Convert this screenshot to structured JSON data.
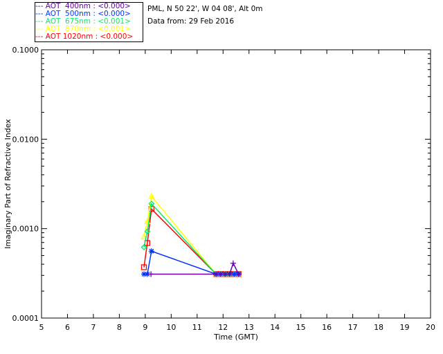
{
  "legend": [
    {
      "label": "--- AOT  400nm : <0.000>",
      "color": "#6600aa"
    },
    {
      "label": "--- AOT  500nm : <0.000>",
      "color": "#0033ff"
    },
    {
      "label": "--- AOT  675nm : <0.001>",
      "color": "#00ee66"
    },
    {
      "label": "--- AOT  870nm : <0.001>",
      "color": "#ffff00"
    },
    {
      "label": "--- AOT 1020nm : <0.000>",
      "color": "#ff0000"
    }
  ],
  "header": {
    "location": "PML, N 50 22', W 04 08', Alt 0m",
    "date": "Data from: 29 Feb 2016"
  },
  "chart_data": {
    "type": "line",
    "xlabel": "Time (GMT)",
    "ylabel": "Imaginary Part of Refractive Index",
    "xlim": [
      5,
      20
    ],
    "ylim": [
      0.0001,
      0.1
    ],
    "yscale": "log",
    "xticks": [
      "5",
      "6",
      "7",
      "8",
      "9",
      "10",
      "11",
      "12",
      "13",
      "14",
      "15",
      "16",
      "17",
      "18",
      "19",
      "20"
    ],
    "yticks": [
      "0.0001",
      "0.0010",
      "0.0100",
      "0.1000"
    ],
    "series": [
      {
        "name": "AOT 400nm",
        "color": "#6600aa",
        "marker": "plus",
        "x": [
          9.22,
          11.73,
          11.9,
          12.08,
          12.25,
          12.39,
          12.6
        ],
        "y": [
          0.00031,
          0.00031,
          0.00031,
          0.00031,
          0.00031,
          0.00041,
          0.00031
        ]
      },
      {
        "name": "AOT 500nm",
        "color": "#0033ff",
        "marker": "asterisk",
        "x": [
          8.95,
          9.08,
          9.24,
          11.73,
          11.9,
          12.08,
          12.25,
          12.43,
          12.6
        ],
        "y": [
          0.00031,
          0.00031,
          0.00056,
          0.00031,
          0.00031,
          0.00031,
          0.00031,
          0.00031,
          0.00031
        ]
      },
      {
        "name": "AOT 675nm",
        "color": "#00ee66",
        "marker": "diamond",
        "x": [
          8.95,
          9.08,
          9.24,
          11.73,
          11.9,
          12.08,
          12.25,
          12.43,
          12.6
        ],
        "y": [
          0.00062,
          0.00093,
          0.0019,
          0.00031,
          0.00031,
          0.00031,
          0.00031,
          0.00031,
          0.00031
        ]
      },
      {
        "name": "AOT 870nm",
        "color": "#ffff00",
        "marker": "triangle",
        "x": [
          8.95,
          9.08,
          9.24,
          11.73,
          11.9,
          12.08,
          12.25,
          12.43,
          12.6
        ],
        "y": [
          0.00081,
          0.0012,
          0.0023,
          0.00031,
          0.00031,
          0.00031,
          0.00031,
          0.00031,
          0.00031
        ]
      },
      {
        "name": "AOT 1020nm",
        "color": "#ff0000",
        "marker": "square",
        "x": [
          8.95,
          9.08,
          9.24,
          11.73,
          11.9,
          12.08,
          12.25,
          12.43,
          12.6
        ],
        "y": [
          0.00037,
          0.00069,
          0.00166,
          0.00031,
          0.00031,
          0.00031,
          0.00031,
          0.00031,
          0.00031
        ]
      }
    ]
  }
}
